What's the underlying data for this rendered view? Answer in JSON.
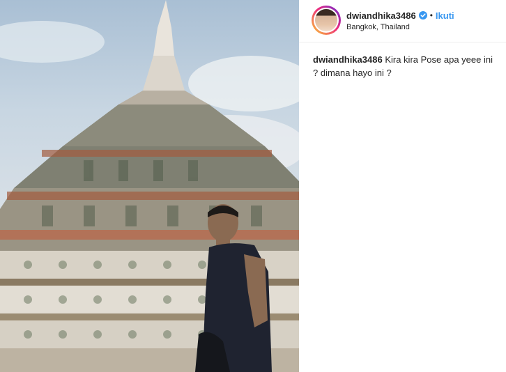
{
  "post": {
    "image_alt": "Man posing in front of a tall ornate temple spire"
  },
  "header": {
    "username": "dwiandhika3486",
    "verified_icon": "verified-badge-icon",
    "separator": "•",
    "follow_label": "Ikuti",
    "location": "Bangkok, Thailand"
  },
  "caption": {
    "username": "dwiandhika3486",
    "text": " Kira kira Pose apa yeee ini ? dimana hayo ini ?"
  },
  "colors": {
    "follow": "#3897f0",
    "text": "#262626",
    "verified": "#3897f0"
  }
}
